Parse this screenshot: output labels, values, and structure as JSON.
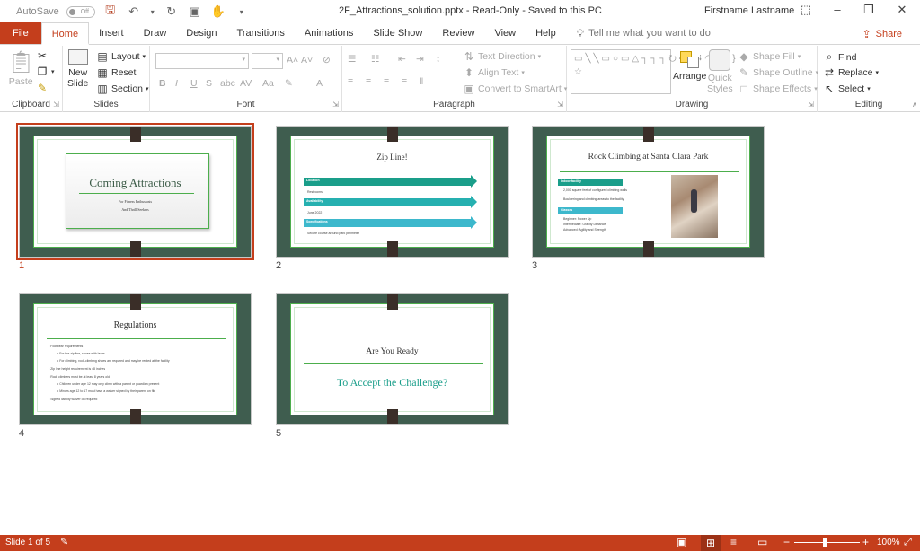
{
  "titlebar": {
    "autosave_label": "AutoSave",
    "autosave_state": "Off",
    "document_title": "2F_Attractions_solution.pptx  -  Read-Only  -  Saved to this PC",
    "user_name": "Firstname Lastname"
  },
  "tabs": [
    {
      "label": "File"
    },
    {
      "label": "Home"
    },
    {
      "label": "Insert"
    },
    {
      "label": "Draw"
    },
    {
      "label": "Design"
    },
    {
      "label": "Transitions"
    },
    {
      "label": "Animations"
    },
    {
      "label": "Slide Show"
    },
    {
      "label": "Review"
    },
    {
      "label": "View"
    },
    {
      "label": "Help"
    }
  ],
  "tell_me": {
    "placeholder": "Tell me what you want to do"
  },
  "share_label": "Share",
  "ribbon": {
    "clipboard": {
      "group": "Clipboard",
      "paste": "Paste"
    },
    "slides": {
      "group": "Slides",
      "new_slide_1": "New",
      "new_slide_2": "Slide",
      "layout": "Layout",
      "reset": "Reset",
      "section": "Section"
    },
    "font": {
      "group": "Font"
    },
    "paragraph": {
      "group": "Paragraph",
      "text_direction": "Text Direction",
      "align_text": "Align Text",
      "convert_smartart": "Convert to SmartArt"
    },
    "drawing": {
      "group": "Drawing",
      "arrange": "Arrange",
      "quick_styles_1": "Quick",
      "quick_styles_2": "Styles",
      "shape_fill": "Shape Fill",
      "shape_outline": "Shape Outline",
      "shape_effects": "Shape Effects"
    },
    "editing": {
      "group": "Editing",
      "find": "Find",
      "replace": "Replace",
      "select": "Select"
    }
  },
  "slides": [
    {
      "number": "1",
      "title": "Coming Attractions",
      "subtitle_1": "For Fitness Enthusiasts",
      "subtitle_2": "And Thrill Seekers"
    },
    {
      "number": "2",
      "title": "Zip Line!",
      "items": [
        "Location",
        "Restrooms",
        "Availability",
        "June 2022",
        "Specifications",
        "Secure course around park perimeter"
      ]
    },
    {
      "number": "3",
      "title": "Rock Climbing at Santa Clara Park",
      "box1_title": "Indoor facility",
      "box1_lines": [
        "2,000 square feet of configured climbing walls",
        "Bouldering and climbing areas to the facility"
      ],
      "box2_title": "Classes",
      "box2_lines": [
        "Beginner: Power Up",
        "Intermediate: Gravity Defiance",
        "Advanced: Agility and Strength"
      ]
    },
    {
      "number": "4",
      "title": "Regulations",
      "lines": [
        "Footwear requirements",
        "For the zip line, shoes with laces",
        "For climbing, rock-climbing shoes are required and may be rented at the facility",
        "Zip line height requirement is 48 inches",
        "Rock climbers must be at least 8 years old",
        "Children under age 12 may only climb with a parent or guardian present",
        "Minors age 12 to 17 must have a waiver signed by their parent on file",
        "Signed liability waiver on required"
      ]
    },
    {
      "number": "5",
      "title": "Are You Ready",
      "subtitle": "To Accept the Challenge?"
    }
  ],
  "status": {
    "slide_info": "Slide 1 of 5",
    "zoom": "100%"
  },
  "colors": {
    "accent": "#c43e1c",
    "slide_border": "#3f5d4f",
    "slide_green": "#4cae4c",
    "teal": "#1a9e8a"
  }
}
